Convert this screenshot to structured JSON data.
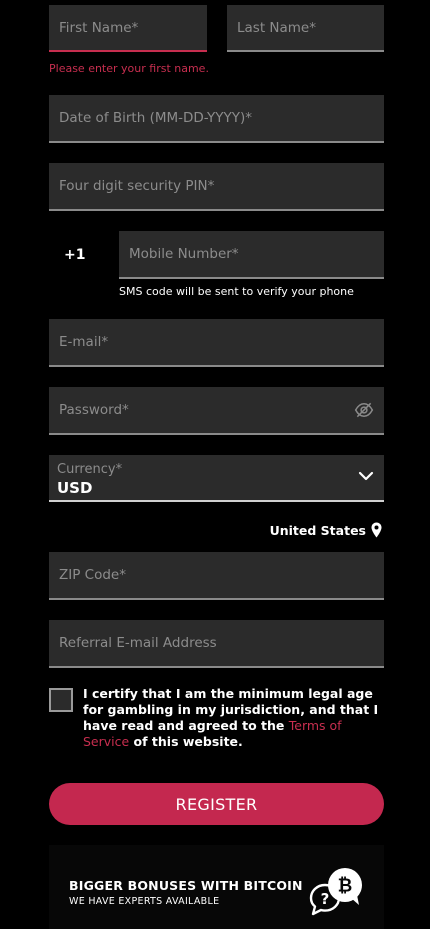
{
  "form": {
    "first_name_placeholder": "First Name*",
    "first_name_error": "Please enter your first name.",
    "last_name_placeholder": "Last Name*",
    "dob_placeholder": "Date of Birth (MM-DD-YYYY)*",
    "pin_placeholder": "Four digit security PIN*",
    "phone_prefix": "+1",
    "mobile_placeholder": "Mobile Number*",
    "sms_note": "SMS code will be sent to verify your phone",
    "email_placeholder": "E-mail*",
    "password_placeholder": "Password*",
    "currency_label": "Currency*",
    "currency_value": "USD",
    "country": "United States",
    "zip_placeholder": "ZIP Code*",
    "referral_placeholder": "Referral E-mail Address",
    "certify_before": "I certify that I am the minimum legal age for gambling in my jurisdiction, and that I have read and agreed to the ",
    "terms_link": "Terms of Service",
    "certify_after": " of this website.",
    "register_label": "REGISTER"
  },
  "promo": {
    "title": "BIGGER BONUSES WITH BITCOIN",
    "subtitle": "WE HAVE EXPERTS AVAILABLE",
    "icon": "bitcoin-question-chat-icon"
  },
  "icons": {
    "password_toggle": "eye-slash-icon",
    "currency_dropdown": "chevron-down-icon",
    "location": "map-pin-icon"
  },
  "colors": {
    "accent": "#c4284f",
    "error": "#c72e4f",
    "field_bg": "#2b2b2b",
    "page_bg": "#000000"
  }
}
